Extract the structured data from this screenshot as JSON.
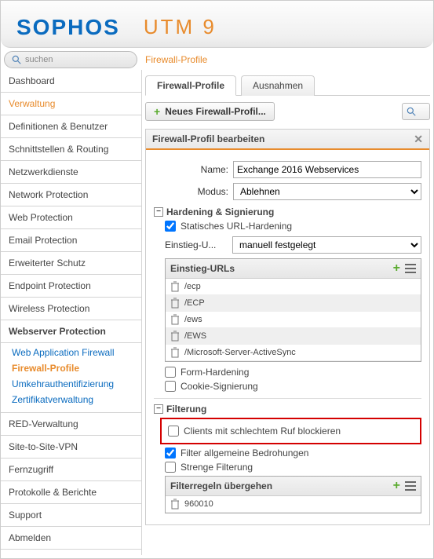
{
  "brand": {
    "sophos": "SOPHOS",
    "product": "UTM 9"
  },
  "search": {
    "placeholder": "suchen"
  },
  "breadcrumb": "Firewall-Profile",
  "sidebar": {
    "items": [
      {
        "label": "Dashboard"
      },
      {
        "label": "Verwaltung"
      },
      {
        "label": "Definitionen & Benutzer"
      },
      {
        "label": "Schnittstellen & Routing"
      },
      {
        "label": "Netzwerkdienste"
      },
      {
        "label": "Network Protection"
      },
      {
        "label": "Web Protection"
      },
      {
        "label": "Email Protection"
      },
      {
        "label": "Erweiterter Schutz"
      },
      {
        "label": "Endpoint Protection"
      },
      {
        "label": "Wireless Protection"
      },
      {
        "label": "Webserver Protection"
      },
      {
        "label": "RED-Verwaltung"
      },
      {
        "label": "Site-to-Site-VPN"
      },
      {
        "label": "Fernzugriff"
      },
      {
        "label": "Protokolle & Berichte"
      },
      {
        "label": "Support"
      },
      {
        "label": "Abmelden"
      }
    ],
    "subnav": [
      {
        "label": "Web Application Firewall"
      },
      {
        "label": "Firewall-Profile"
      },
      {
        "label": "Umkehrauthentifizierung"
      },
      {
        "label": "Zertifikatverwaltung"
      }
    ]
  },
  "tabs": [
    {
      "label": "Firewall-Profile"
    },
    {
      "label": "Ausnahmen"
    }
  ],
  "buttons": {
    "new_profile": "Neues Firewall-Profil..."
  },
  "panel": {
    "title": "Firewall-Profil bearbeiten",
    "name_label": "Name:",
    "name_value": "Exchange 2016 Webservices",
    "mode_label": "Modus:",
    "mode_value": "Ablehnen",
    "section_hardening": "Hardening & Signierung",
    "static_url": "Statisches URL-Hardening",
    "entry_label": "Einstieg-U...",
    "entry_value": "manuell festgelegt",
    "url_list_title": "Einstieg-URLs",
    "urls": [
      "/ecp",
      "/ECP",
      "/ews",
      "/EWS",
      "/Microsoft-Server-ActiveSync"
    ],
    "form_hardening": "Form-Hardening",
    "cookie_signing": "Cookie-Signierung",
    "section_filtering": "Filterung",
    "bad_clients": "Clients mit schlechtem Ruf blockieren",
    "common_threats": "Filter allgemeine Bedrohungen",
    "strict_filter": "Strenge Filterung",
    "rules_bypass_title": "Filterregeln übergehen",
    "rule_entry": "960010"
  }
}
